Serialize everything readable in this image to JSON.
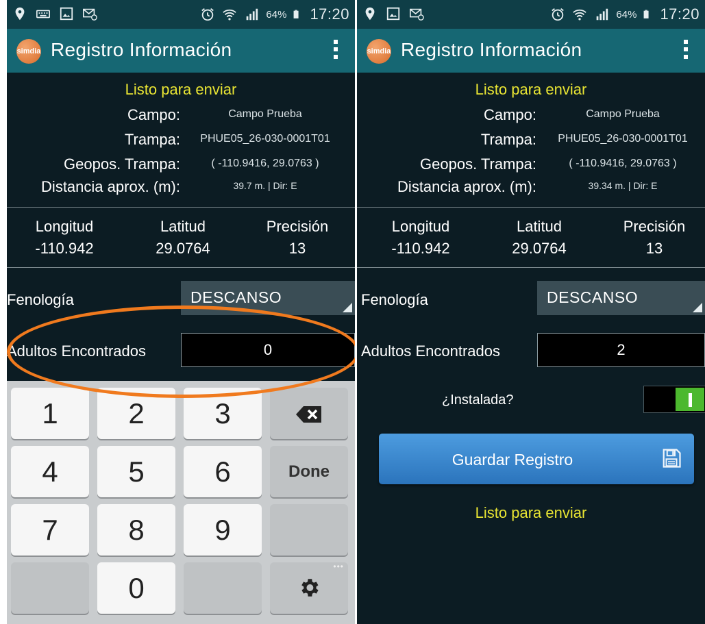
{
  "status_bar": {
    "battery": "64%",
    "time": "17:20"
  },
  "app_bar": {
    "logo_text": "simdia",
    "title": "Registro Información"
  },
  "info": {
    "status": "Listo para enviar",
    "campo_label": "Campo:",
    "trampa_label": "Trampa:",
    "geopos_label": "Geopos. Trampa:",
    "distancia_label": "Distancia aprox. (m):",
    "campo": "Campo Prueba",
    "trampa": "PHUE05_26-030-0001T01",
    "geopos": "( -110.9416, 29.0763 )"
  },
  "coords": {
    "longitud_label": "Longitud",
    "latitud_label": "Latitud",
    "precision_label": "Precisión",
    "longitud": "-110.942",
    "latitud": "29.0764",
    "precision": "13"
  },
  "form": {
    "fenologia_label": "Fenología",
    "fenologia_value": "DESCANSO",
    "adultos_label": "Adultos Encontrados",
    "instalada_label": "¿Instalada?",
    "save_label": "Guardar Registro",
    "footer_status": "Listo para enviar"
  },
  "left_screen": {
    "distancia": "39.7 m. | Dir: E",
    "adultos": "0"
  },
  "right_screen": {
    "distancia": "39.34 m. | Dir: E",
    "adultos": "2",
    "instalada_on": true
  },
  "keyboard": {
    "k1": "1",
    "k2": "2",
    "k3": "3",
    "k4": "4",
    "k5": "5",
    "k6": "6",
    "k7": "7",
    "k8": "8",
    "k9": "9",
    "k0": "0",
    "done": "Done"
  },
  "colors": {
    "status_bar": "#0f3e47",
    "app_bar": "#166773",
    "background": "#0c1c23",
    "status_text": "#e9e533",
    "highlight_ellipse": "#f07a1e",
    "toggle_on": "#4cb82e",
    "save_button": "#3a88d0"
  },
  "icons": {
    "status_left": [
      "location-pin-icon",
      "keyboard-icon",
      "image-icon",
      "email-icon"
    ],
    "status_right": [
      "alarm-icon",
      "wifi-icon",
      "signal-icon",
      "battery-icon"
    ],
    "overflow": "more-vert-icon",
    "backspace": "backspace-icon",
    "settings": "gear-icon",
    "save": "floppy-disk-icon"
  }
}
